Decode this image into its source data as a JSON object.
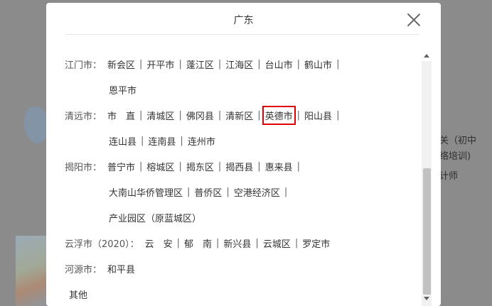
{
  "modal": {
    "title": "广东"
  },
  "rows": [
    {
      "city": "江门市：",
      "items": [
        "新会区",
        "开平市",
        "蓬江区",
        "江海区",
        "台山市",
        "鹤山市"
      ],
      "trailing": true
    },
    {
      "city": "",
      "items": [
        "恩平市"
      ],
      "trailing": false
    },
    {
      "city": "清远市：",
      "items": [
        "市　直",
        "清城区",
        "佛冈县",
        "清新区",
        "英德市",
        "阳山县"
      ],
      "trailing": true,
      "highlight": 4
    },
    {
      "city": "",
      "items": [
        "连山县",
        "连南县",
        "连州市"
      ],
      "trailing": false
    },
    {
      "city": "揭阳市：",
      "items": [
        "普宁市",
        "榕城区",
        "揭东区",
        "揭西县",
        "惠来县"
      ],
      "trailing": true
    },
    {
      "city": "",
      "items": [
        "大南山华侨管理区",
        "普侨区",
        "空港经济区"
      ],
      "trailing": true
    },
    {
      "city": "",
      "items": [
        "产业园区（原蓝城区）"
      ],
      "trailing": false
    },
    {
      "city": "云浮市（2020）：",
      "items": [
        "云　安",
        "郁　南",
        "新兴县",
        "云城区",
        "罗定市"
      ],
      "trailing": false
    },
    {
      "city": "河源市：",
      "items": [
        "和平县"
      ],
      "trailing": false
    },
    {
      "city": "",
      "items": [
        "其他"
      ],
      "trailing": false
    }
  ],
  "background": {
    "t1": "关（初中",
    "t2": "络培训)",
    "t3": "计师"
  },
  "colors": {
    "highlight": "#e00000"
  },
  "icons": {
    "close": "close-icon",
    "scroll_up": "scroll-up-arrow-icon",
    "scroll_down": "scroll-down-arrow-icon"
  }
}
